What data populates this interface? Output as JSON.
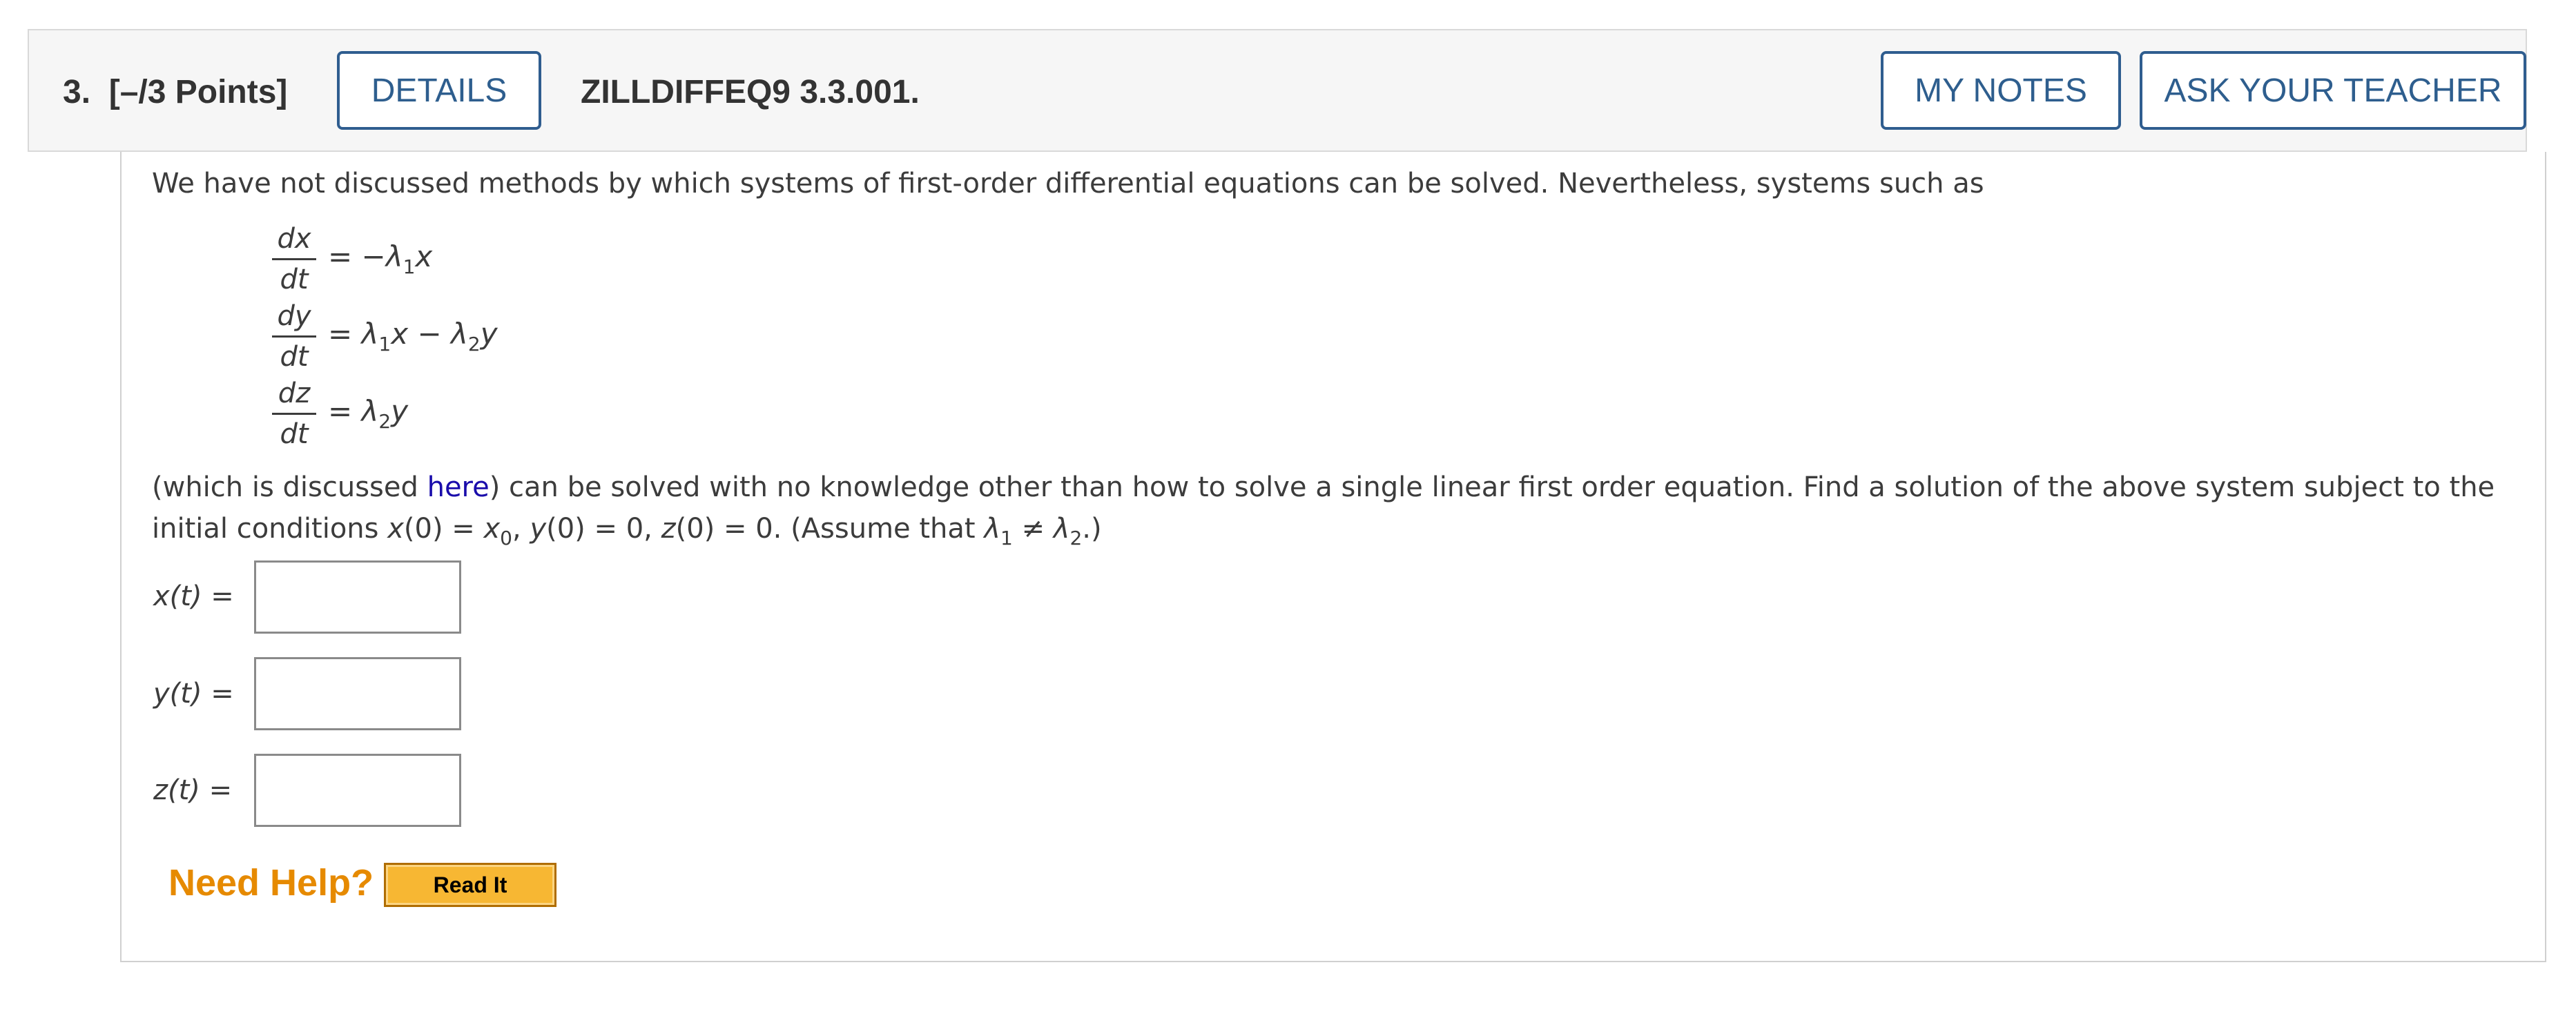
{
  "question": {
    "number": "3.",
    "points": "[–/3 Points]",
    "details_label": "DETAILS",
    "reference": "ZILLDIFFEQ9 3.3.001.",
    "my_notes_label": "MY NOTES",
    "ask_teacher_label": "ASK YOUR TEACHER"
  },
  "problem": {
    "intro": "We have not discussed methods by which systems of first-order differential equations can be solved. Nevertheless, systems such as",
    "equations": [
      {
        "num": "dx",
        "den": "dt"
      },
      {
        "num": "dy",
        "den": "dt"
      },
      {
        "num": "dz",
        "den": "dt"
      }
    ],
    "para_prefix": "(which is discussed ",
    "link_text": "here",
    "para_suffix": ") can be solved with no knowledge other than how to solve a single linear first order equation. Find a solution of the above system subject to the",
    "conditions_prefix": "initial conditions "
  },
  "answers": [
    {
      "label": "x(t)",
      "value": ""
    },
    {
      "label": "y(t)",
      "value": ""
    },
    {
      "label": "z(t)",
      "value": ""
    }
  ],
  "help": {
    "need_help_label": "Need Help?",
    "read_it_label": "Read It"
  },
  "colors": {
    "accent": "#2e5e8e",
    "link": "#1a0dab",
    "help_orange": "#e68a00",
    "read_it_bg": "#f7b733"
  }
}
